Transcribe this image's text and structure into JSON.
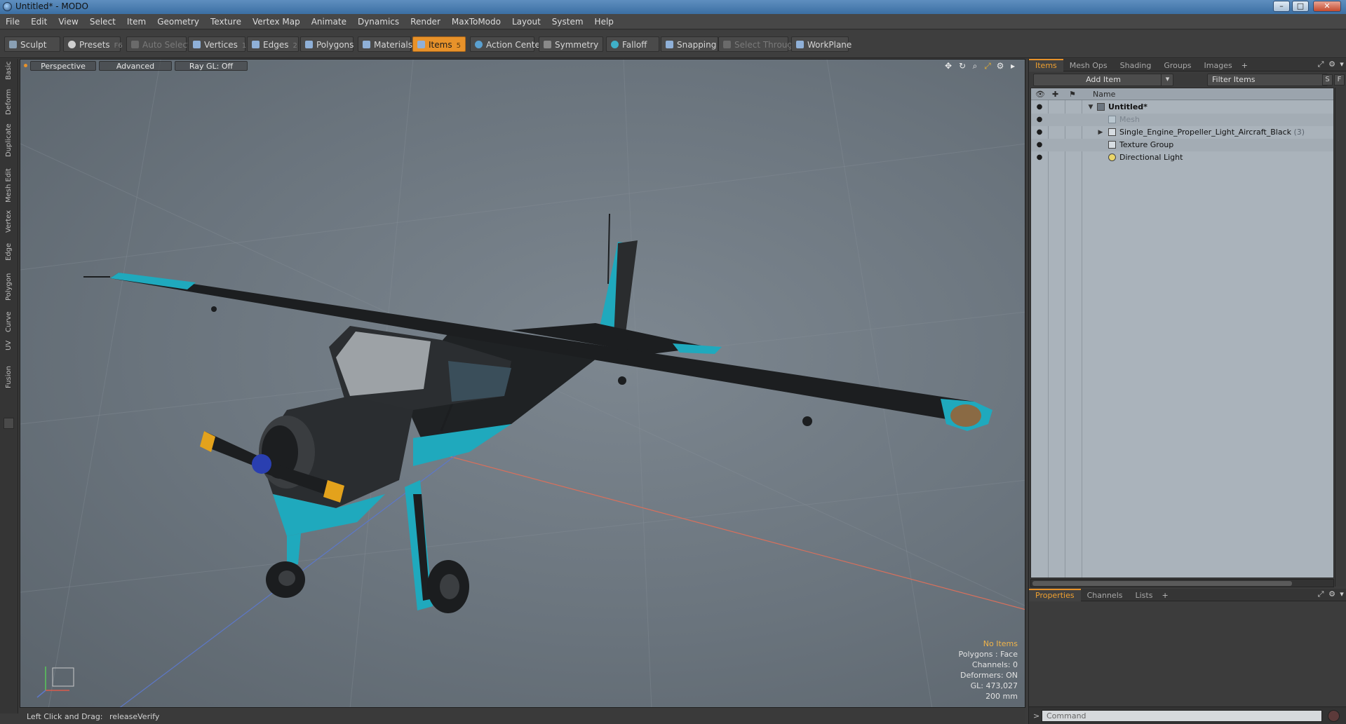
{
  "window": {
    "title": "Untitled* - MODO",
    "controls": [
      "–",
      "□",
      "✕"
    ]
  },
  "menu": [
    "File",
    "Edit",
    "View",
    "Select",
    "Item",
    "Geometry",
    "Texture",
    "Vertex Map",
    "Animate",
    "Dynamics",
    "Render",
    "MaxToModo",
    "Layout",
    "System",
    "Help"
  ],
  "toolbar": {
    "sculpt": "Sculpt",
    "presets": "Presets",
    "presets_key": "F6",
    "auto_select": "Auto Select",
    "vertices": "Vertices",
    "vertices_key": "1",
    "edges": "Edges",
    "edges_key": "2",
    "polygons": "Polygons",
    "materials": "Materials",
    "items": "Items",
    "items_key": "5",
    "action_center": "Action Center",
    "symmetry": "Symmetry",
    "falloff": "Falloff",
    "snapping": "Snapping",
    "select_through": "Select Through",
    "workplane": "WorkPlane"
  },
  "left_tabs": [
    "Basic",
    "Deform",
    "Duplicate",
    "Mesh Edit",
    "Vertex",
    "Edge",
    "Polygon",
    "Curve",
    "UV",
    "Fusion"
  ],
  "viewport": {
    "view_mode": "Perspective",
    "shading": "Advanced",
    "raygl": "Ray GL: Off",
    "info": {
      "selection": "No Items",
      "polygons": "Polygons : Face",
      "channels": "Channels: 0",
      "deformers": "Deformers: ON",
      "gl": "GL: 473,027",
      "scale": "200 mm"
    },
    "colors": {
      "wing": "#1c1e20",
      "accent": "#1fa9bd",
      "prop_tip": "#e3a21c",
      "spinner": "#2a3fb0"
    }
  },
  "status": {
    "hint": "Left Click and Drag:",
    "command": "releaseVerify"
  },
  "right_panel": {
    "tabs": [
      "Items",
      "Mesh Ops",
      "Shading",
      "Groups",
      "Images"
    ],
    "add_item": "Add Item",
    "filter_placeholder": "Filter Items",
    "btn_s": "S",
    "btn_f": "F",
    "column_name": "Name",
    "tree": [
      {
        "label": "Untitled*",
        "count": "",
        "icon": "scene-icon"
      },
      {
        "label": "Mesh",
        "count": "",
        "icon": "mesh-icon"
      },
      {
        "label": "Single_Engine_Propeller_Light_Aircraft_Black",
        "count": "(3)",
        "icon": "group-icon"
      },
      {
        "label": "Texture Group",
        "count": "",
        "icon": "group-icon"
      },
      {
        "label": "Directional Light",
        "count": "",
        "icon": "light-icon"
      }
    ],
    "bottom_tabs": [
      "Properties",
      "Channels",
      "Lists"
    ],
    "command_placeholder": "Command"
  }
}
